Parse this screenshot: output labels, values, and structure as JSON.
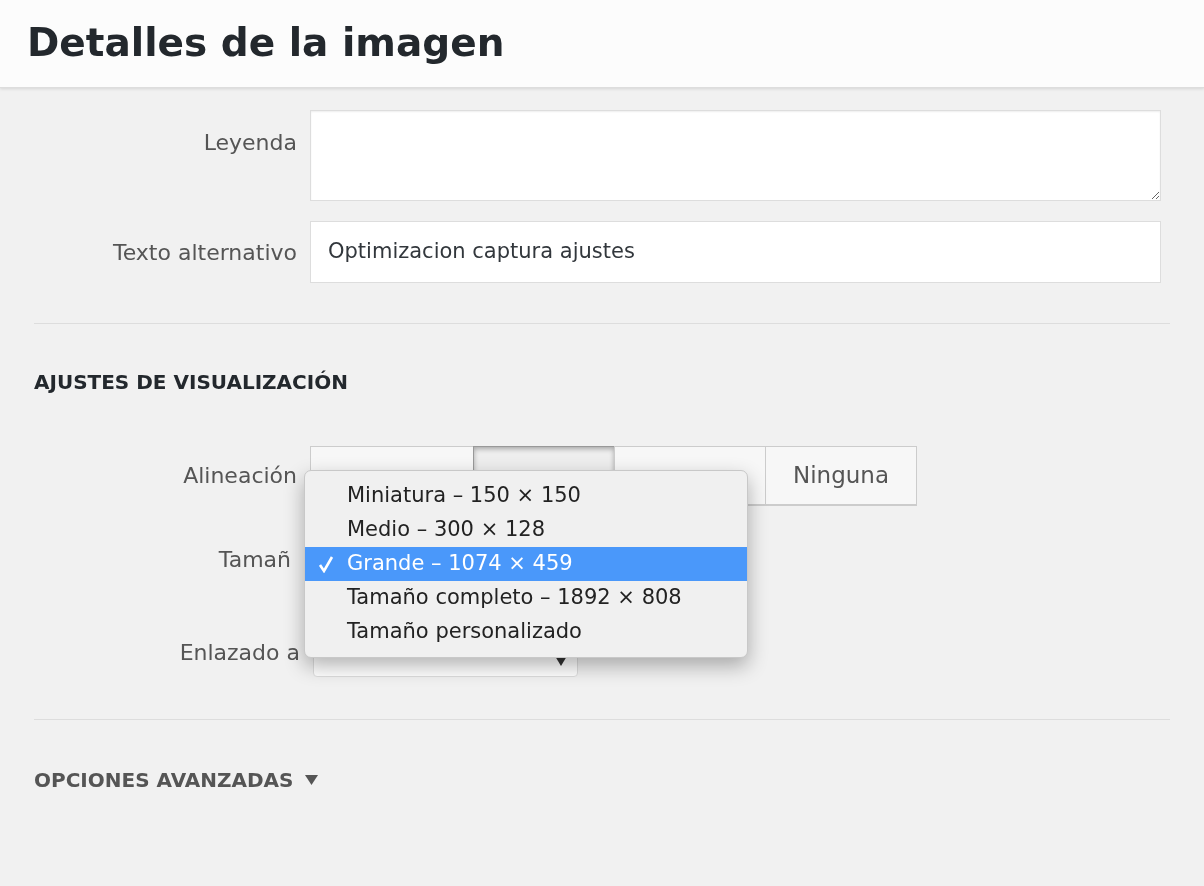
{
  "header": {
    "title": "Detalles de la imagen"
  },
  "caption": {
    "label": "Leyenda"
  },
  "alt_text": {
    "label": "Texto alternativo",
    "value": "Optimizacion captura ajustes"
  },
  "display_settings": {
    "heading": "AJUSTES DE VISUALIZACIÓN",
    "alignment": {
      "label": "Alineación",
      "options": [
        {
          "selected": false
        },
        {
          "selected": true
        },
        {
          "selected": false
        },
        {
          "label": "Ninguna",
          "selected": false
        }
      ]
    },
    "size": {
      "label": "Tamañ",
      "menu": [
        {
          "label": "Miniatura – 150 × 150",
          "selected": false
        },
        {
          "label": "Medio – 300 × 128",
          "selected": false
        },
        {
          "label": "Grande – 1074 × 459",
          "selected": true
        },
        {
          "label": "Tamaño completo – 1892 × 808",
          "selected": false
        },
        {
          "label": "Tamaño personalizado",
          "selected": false
        }
      ]
    },
    "link_to": {
      "label": "Enlazado a"
    }
  },
  "advanced": {
    "label": "OPCIONES AVANZADAS",
    "expanded": false
  }
}
